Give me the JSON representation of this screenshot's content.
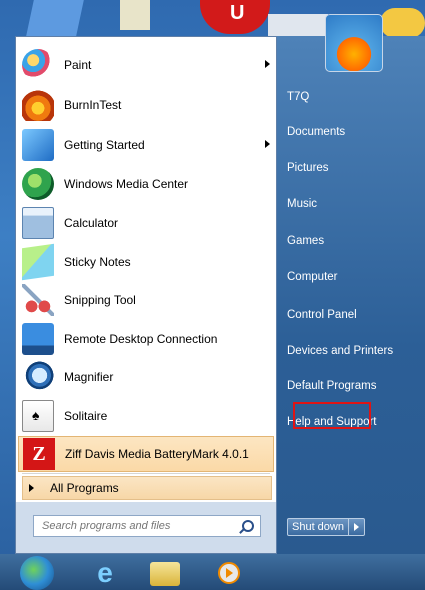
{
  "left_programs": [
    {
      "label": "Paint",
      "icon": "paint-icon",
      "has_submenu": true
    },
    {
      "label": "BurnInTest",
      "icon": "burnintest-icon",
      "has_submenu": false
    },
    {
      "label": "Getting Started",
      "icon": "getting-started-icon",
      "has_submenu": true
    },
    {
      "label": "Windows Media Center",
      "icon": "media-center-icon",
      "has_submenu": false
    },
    {
      "label": "Calculator",
      "icon": "calculator-icon",
      "has_submenu": false
    },
    {
      "label": "Sticky Notes",
      "icon": "sticky-notes-icon",
      "has_submenu": false
    },
    {
      "label": "Snipping Tool",
      "icon": "snipping-tool-icon",
      "has_submenu": false
    },
    {
      "label": "Remote Desktop Connection",
      "icon": "remote-desktop-icon",
      "has_submenu": false
    },
    {
      "label": "Magnifier",
      "icon": "magnifier-icon",
      "has_submenu": false
    },
    {
      "label": "Solitaire",
      "icon": "solitaire-icon",
      "has_submenu": false
    },
    {
      "label": "Ziff Davis Media BatteryMark 4.0.1",
      "icon": "ziff-davis-icon",
      "has_submenu": false,
      "highlighted": true
    }
  ],
  "all_programs": "All Programs",
  "search": {
    "placeholder": "Search programs and files"
  },
  "right_items": [
    "T7Q",
    "Documents",
    "Pictures",
    "Music",
    "Games",
    "Computer",
    "Control Panel",
    "Devices and Printers",
    "Default Programs",
    "Help and Support"
  ],
  "shutdown": {
    "label": "Shut down"
  },
  "wallpaper_letter": "U",
  "taskbar_ie_glyph": "e",
  "colors": {
    "highlight": "#fbd9a7",
    "right_pane": "#3a6ea5",
    "annotation_box": "#e01414"
  }
}
